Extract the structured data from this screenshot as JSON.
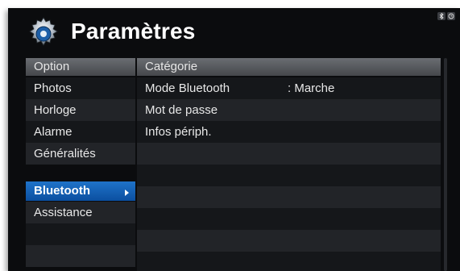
{
  "header": {
    "title": "Paramètres"
  },
  "status_icons": [
    "bluetooth-icon",
    "clock-icon"
  ],
  "left_panel": {
    "header": "Option",
    "items": [
      {
        "label": "Photos"
      },
      {
        "label": "Horloge"
      },
      {
        "label": "Alarme"
      },
      {
        "label": "Généralités"
      },
      {
        "label": "Bluetooth",
        "selected": true
      },
      {
        "label": "Assistance"
      },
      {
        "label": ""
      },
      {
        "label": ""
      }
    ]
  },
  "right_panel": {
    "header": "Catégorie",
    "rows": [
      {
        "label": "Mode Bluetooth",
        "value": ": Marche"
      },
      {
        "label": "Mot de passe",
        "value": ""
      },
      {
        "label": "Infos périph.",
        "value": ""
      },
      {
        "label": "",
        "value": ""
      },
      {
        "label": "",
        "value": ""
      },
      {
        "label": "",
        "value": ""
      },
      {
        "label": "",
        "value": ""
      },
      {
        "label": "",
        "value": ""
      }
    ]
  },
  "colors": {
    "background": "#0b0c0e",
    "selection": "#1565c0",
    "header_bar": "#5a5d62"
  }
}
